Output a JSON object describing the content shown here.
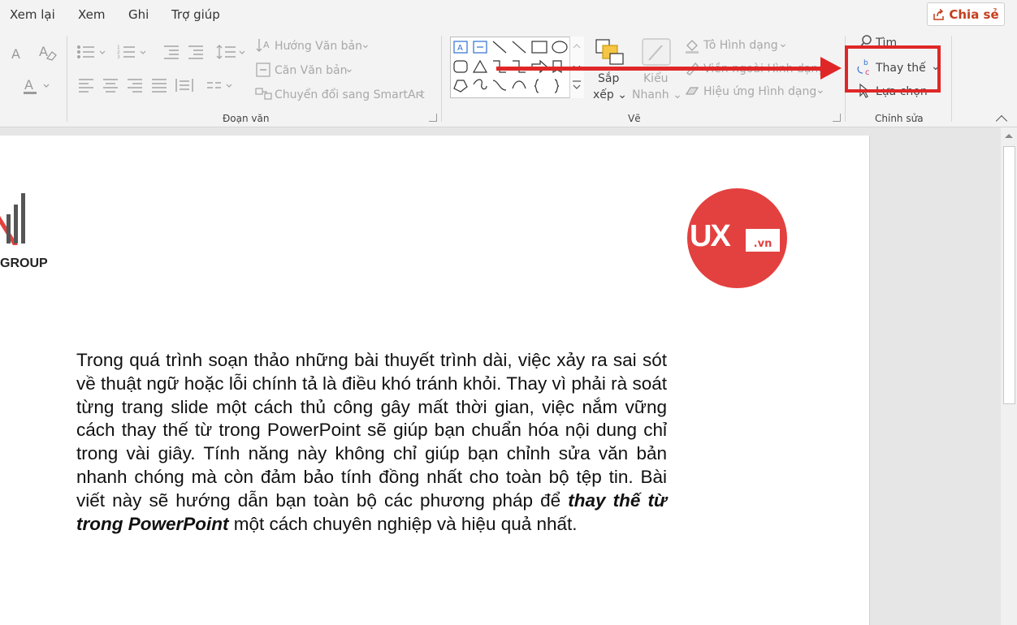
{
  "menubar": {
    "items": [
      "Xem lại",
      "Xem",
      "Ghi",
      "Trợ giúp"
    ],
    "share_label": "Chia sẻ"
  },
  "ribbon": {
    "paragraph": {
      "text_direction": "Hướng Văn bản",
      "align_text": "Căn Văn bản",
      "convert_smartart": "Chuyển đổi sang SmartArt",
      "label": "Đoạn văn"
    },
    "drawing": {
      "arrange_label": "Sắp xếp",
      "quick_styles_label": "Kiểu Nhanh",
      "shape_fill": "Tô Hình dạng",
      "shape_outline": "Viền ngoài Hình dạng",
      "shape_effects": "Hiệu ứng Hình dạng",
      "label": "Vẽ"
    },
    "editing": {
      "find": "Tìm",
      "replace": "Thay thế",
      "select": "Lựa chọn",
      "label": "Chỉnh sửa"
    }
  },
  "slide": {
    "left_logo_text": "GROUP",
    "right_logo_text": "UX",
    "right_logo_suffix": ".vn",
    "paragraph_start": "Trong quá trình soạn thảo những bài thuyết trình dài, việc xảy ra sai sót về thuật ngữ hoặc lỗi chính tả là điều khó tránh khỏi. Thay vì phải rà soát từng trang slide một cách thủ công gây mất thời gian, việc nắm vững cách thay thế từ trong PowerPoint sẽ giúp bạn chuẩn hóa nội dung chỉ trong vài giây. Tính năng này không chỉ giúp bạn chỉnh sửa văn bản nhanh chóng mà còn đảm bảo tính đồng nhất cho toàn bộ tệp tin. Bài viết này sẽ hướng dẫn bạn toàn bộ các phương pháp để ",
    "paragraph_emphasis": "thay thế từ trong PowerPoint",
    "paragraph_end": " một cách chuyên nghiệp và hiệu quả nhất."
  },
  "colors": {
    "accent_red": "#e02727",
    "logo_red": "#e2413f",
    "share_orange": "#c43e1c"
  }
}
